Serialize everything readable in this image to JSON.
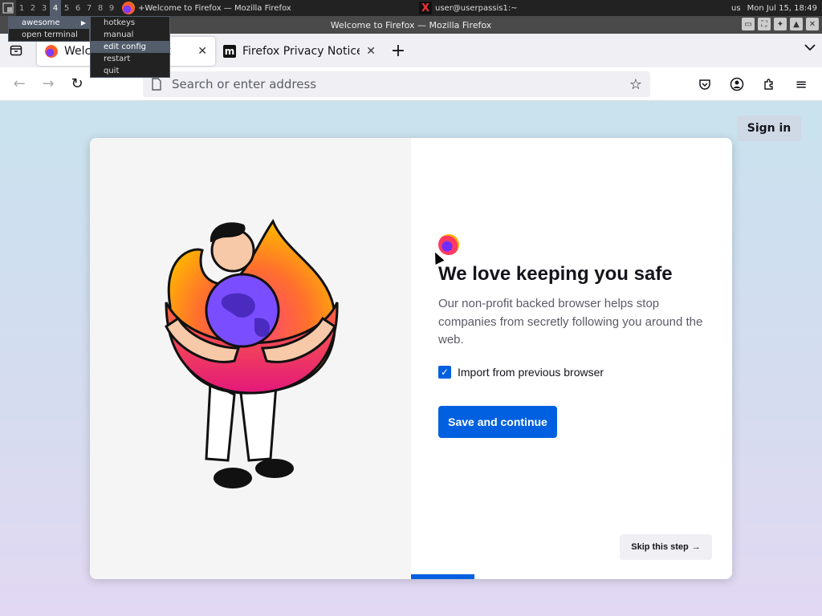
{
  "wibar": {
    "tags": [
      "1",
      "2",
      "3",
      "4",
      "5",
      "6",
      "7",
      "8",
      "9"
    ],
    "active_tag": "4",
    "tasks": [
      {
        "title": "+Welcome to Firefox — Mozilla Firefox"
      },
      {
        "title": "user@userpassis1:~"
      }
    ],
    "keyboard_layout": "us",
    "clock": "Mon Jul 15, 18:49"
  },
  "awesome_menu": {
    "items": [
      {
        "label": "awesome"
      },
      {
        "label": "open terminal"
      }
    ],
    "submenu": {
      "items": [
        {
          "label": "hotkeys"
        },
        {
          "label": "manual"
        },
        {
          "label": "edit config"
        },
        {
          "label": "restart"
        },
        {
          "label": "quit"
        }
      ],
      "selected": "edit config"
    }
  },
  "window": {
    "title": "Welcome to Firefox — Mozilla Firefox"
  },
  "tabs": [
    {
      "label": "Welcome to Firefox",
      "active": true
    },
    {
      "label": "Firefox Privacy Notice — Mozilla",
      "active": false
    }
  ],
  "urlbar": {
    "placeholder": "Search or enter address"
  },
  "page": {
    "signin_label": "Sign in",
    "headline": "We love keeping you safe",
    "subtext": "Our non-profit backed browser helps stop companies from secretly following you around the web.",
    "import_label": "Import from previous browser",
    "import_checked": true,
    "save_label": "Save and continue",
    "skip_label": "Skip this step",
    "progress_fraction": 0.2
  },
  "colors": {
    "primary_button": "#0060df",
    "headline": "#15141a"
  }
}
